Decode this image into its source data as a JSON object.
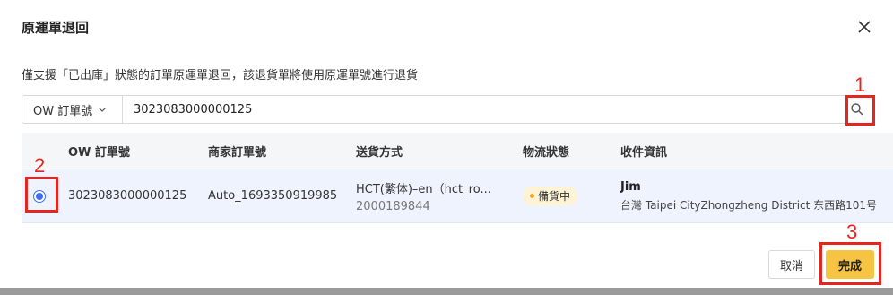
{
  "dialog": {
    "title": "原運單退回",
    "description": "僅支援「已出庫」狀態的訂單原運單退回，該退貨單將使用原運單號進行退貨"
  },
  "search": {
    "type_label": "OW 訂單號",
    "value": "3023083000000125",
    "search_icon": "search-icon"
  },
  "table": {
    "headers": [
      "OW 訂單號",
      "商家訂單號",
      "送貨方式",
      "物流狀態",
      "收件資訊"
    ],
    "rows": [
      {
        "selected": true,
        "ow_order": "3023083000000125",
        "merchant_order": "Auto_1693350919985",
        "shipping_method": "HCT(繁体)–en（hct_ro...",
        "tracking_no": "2000189844",
        "status": "備貨中",
        "recipient_name": "Jim",
        "recipient_address": "台灣 Taipei CityZhongzheng District 东西路101号"
      }
    ]
  },
  "footer": {
    "cancel_label": "取消",
    "done_label": "完成"
  },
  "annotations": [
    "1",
    "2",
    "3"
  ],
  "colors": {
    "accent": "#3d6df2",
    "primary_button": "#f6c343",
    "annotation": "#e5261f",
    "status_badge": "#fff3d6"
  }
}
